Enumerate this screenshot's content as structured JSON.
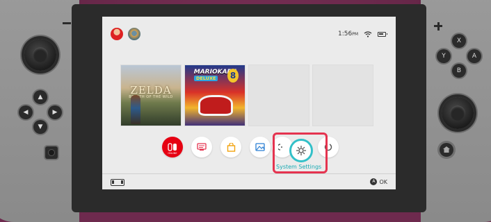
{
  "status": {
    "time": "1:56",
    "ampm": "PM"
  },
  "games": [
    {
      "title_main": "ZELDA",
      "title_sub": "BREATH OF THE WILD"
    },
    {
      "title_main": "MARIOKART",
      "title_sub": "DELUXE",
      "badge": "8"
    }
  ],
  "dock": {
    "online_caption": "ONLINE",
    "selected_label": "System Settings"
  },
  "face_buttons": {
    "x": "X",
    "y": "Y",
    "a": "A",
    "b": "B"
  },
  "footer": {
    "confirm_button": "A",
    "confirm_label": "OK"
  },
  "colors": {
    "background": "#6e2a4e",
    "screen": "#ebebeb",
    "selection_outline": "#e5334f",
    "selection_ring": "#33c0c8",
    "selection_text": "#19aab3",
    "online": "#e60012"
  }
}
